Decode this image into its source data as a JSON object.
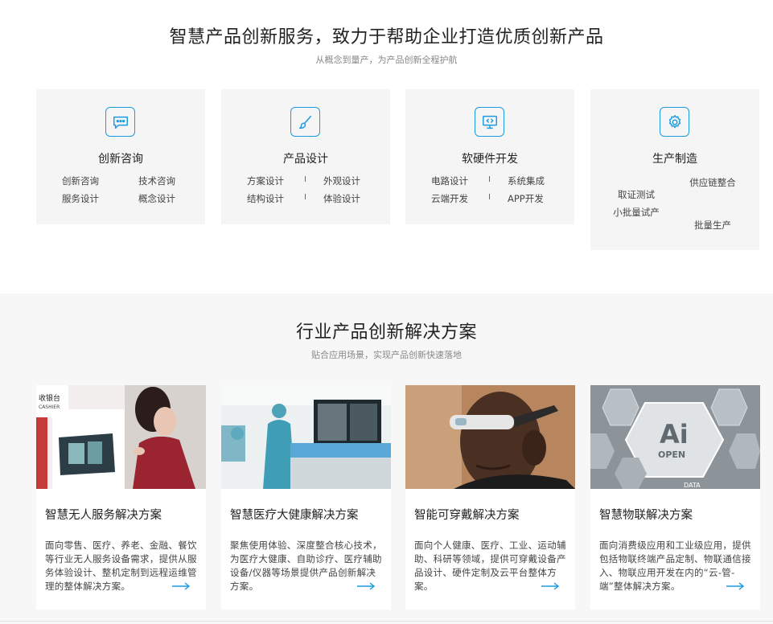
{
  "section1": {
    "title": "智慧产品创新服务，致力于帮助企业打造优质创新产品",
    "subtitle": "从概念到量产，为产品创新全程护航",
    "cards": [
      {
        "icon": "chat-bubble-icon",
        "name": "创新咨询",
        "rows": [
          [
            "创新咨询",
            "技术咨询"
          ],
          [
            "服务设计",
            "概念设计"
          ]
        ]
      },
      {
        "icon": "brush-icon",
        "name": "产品设计",
        "rows": [
          [
            "方案设计",
            "外观设计"
          ],
          [
            "结构设计",
            "体验设计"
          ]
        ]
      },
      {
        "icon": "code-monitor-icon",
        "name": "软硬件开发",
        "rows": [
          [
            "电路设计",
            "系统集成"
          ],
          [
            "云端开发",
            "APP开发"
          ]
        ]
      },
      {
        "icon": "gear-icon",
        "name": "生产制造",
        "items": [
          "供应链整合",
          "取证测试",
          "小批量试产",
          "批量生产"
        ]
      }
    ],
    "separator": "I"
  },
  "section2": {
    "title": "行业产品创新解决方案",
    "subtitle": "贴合应用场景，实现产品创新快速落地",
    "cards": [
      {
        "name": "智慧无人服务解决方案",
        "desc": "面向零售、医疗、养老、金融、餐饮等行业无人服务设备需求，提供从服务体验设计、整机定制到远程运维管理的整体解决方案。",
        "image_sign_top": "收银台",
        "image_sign_bottom": "CASHIER"
      },
      {
        "name": "智慧医疗大健康解决方案",
        "desc": "聚焦使用体验、深度整合核心技术，为医疗大健康、自助诊疗、医疗辅助设备/仪器等场景提供产品创新解决方案。"
      },
      {
        "name": "智能可穿戴解决方案",
        "desc": "面向个人健康、医疗、工业、运动辅助、科研等领域，提供可穿戴设备产品设计、硬件定制及云平台整体方案。"
      },
      {
        "name": "智慧物联解决方案",
        "desc": "面向消费级应用和工业级应用，提供包括物联终端产品定制、物联通信接入、物联应用开发在内的“云-管-端”整体解决方案。",
        "image_text_ai": "Ai",
        "image_text_open": "OPEN",
        "image_text_data": "DATA"
      }
    ]
  },
  "colors": {
    "accent": "#1b9be0",
    "card_bg": "#f5f5f5",
    "section2_bg": "#f7f7f7"
  }
}
